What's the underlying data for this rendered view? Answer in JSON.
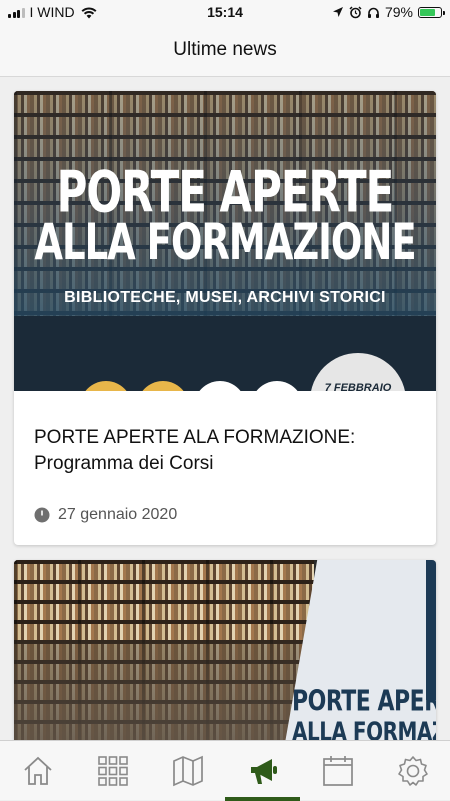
{
  "status_bar": {
    "carrier": "I WIND",
    "time": "15:14",
    "battery_percent": "79%",
    "battery_level": 0.79
  },
  "header": {
    "title": "Ultime news"
  },
  "news": [
    {
      "banner_title_line1": "PORTE APERTE",
      "banner_title_line2": "ALLA FORMAZIONE",
      "banner_subtitle": "BIBLIOTECHE, MUSEI, ARCHIVI STORICI",
      "banner_date": "7 FEBBRAIO",
      "title": "PORTE APERTE ALA FORMAZIONE: Programma dei Corsi",
      "date": "27 gennaio 2020"
    },
    {
      "banner_title_line1": "PORTE APER",
      "banner_title_line2": "ALLA FORMAZIO"
    }
  ],
  "tab_bar": {
    "items": [
      "home-icon",
      "grid-icon",
      "map-icon",
      "megaphone-icon",
      "calendar-icon",
      "settings-icon"
    ],
    "active_index": 3,
    "active_color": "#2f5b1a",
    "inactive_color": "#8a8a8a"
  }
}
